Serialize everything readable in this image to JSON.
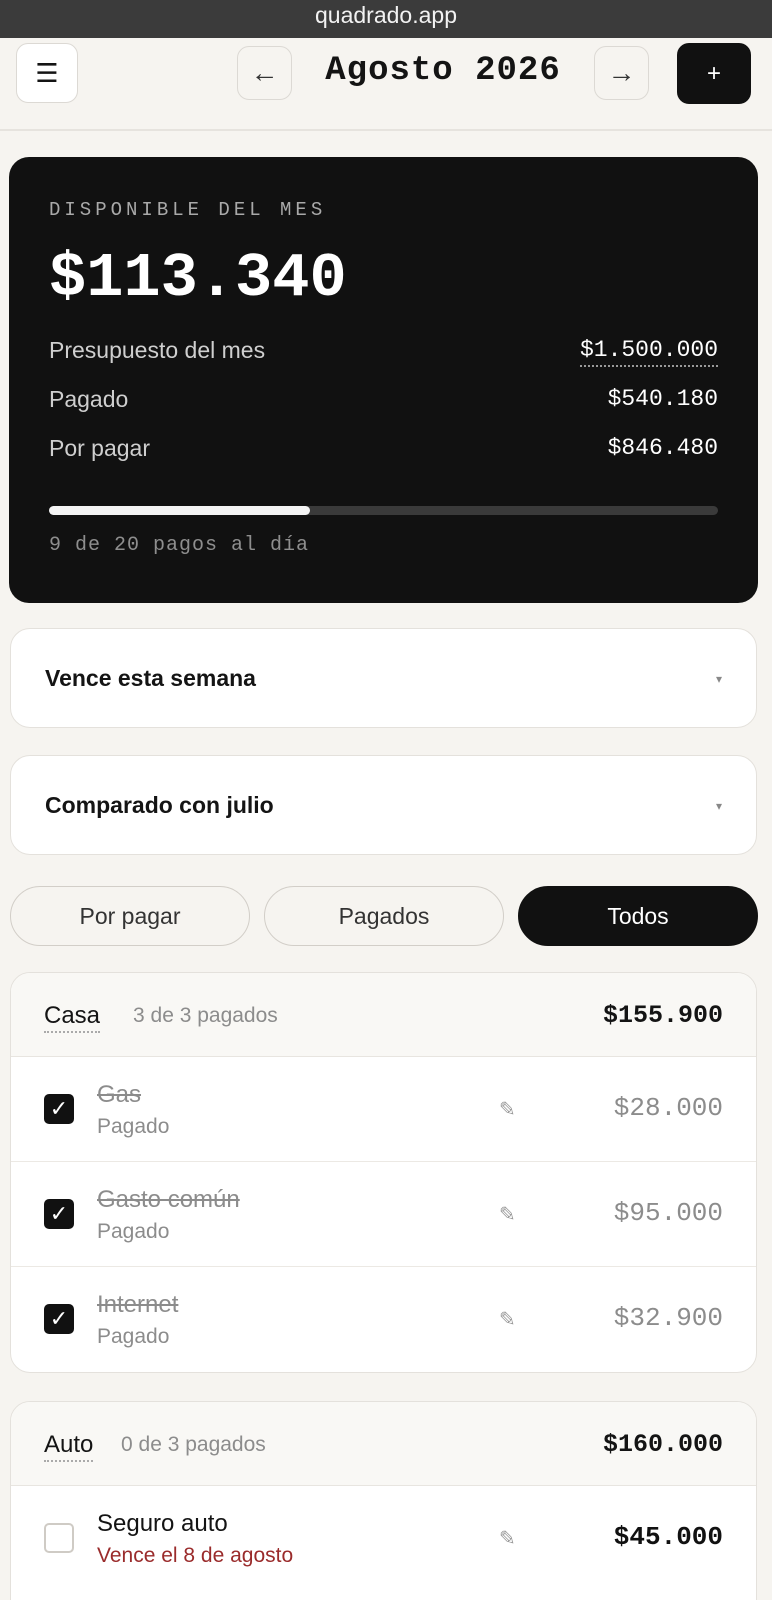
{
  "browser": {
    "url": "quadrado.app"
  },
  "header": {
    "menu_icon": "☰",
    "prev_icon": "←",
    "month_title": "Agosto 2026",
    "next_icon": "→",
    "add_icon": "+"
  },
  "summary": {
    "label": "DISPONIBLE DEL MES",
    "available": "$113.340",
    "rows": [
      {
        "label": "Presupuesto del mes",
        "value": "$1.500.000"
      },
      {
        "label": "Pagado",
        "value": "$540.180"
      },
      {
        "label": "Por pagar",
        "value": "$846.480"
      }
    ],
    "progress_fraction": 0.39,
    "footer": "9 de 20 pagos al día"
  },
  "panels": [
    {
      "title": "Vence esta semana",
      "caret": "▾"
    },
    {
      "title": "Comparado con julio",
      "caret": "▾"
    }
  ],
  "filters": [
    {
      "label": "Por pagar",
      "active": false
    },
    {
      "label": "Pagados",
      "active": false
    },
    {
      "label": "Todos",
      "active": true
    }
  ],
  "groups": [
    {
      "name": "Casa",
      "count": "3 de 3 pagados",
      "total": "$155.900",
      "items": [
        {
          "name": "Gas",
          "status": "Pagado",
          "amount": "$28.000",
          "paid": true,
          "check": "✓",
          "edit_icon": "✎"
        },
        {
          "name": "Gasto común",
          "status": "Pagado",
          "amount": "$95.000",
          "paid": true,
          "check": "✓",
          "edit_icon": "✎"
        },
        {
          "name": "Internet",
          "status": "Pagado",
          "amount": "$32.900",
          "paid": true,
          "check": "✓",
          "edit_icon": "✎"
        }
      ]
    },
    {
      "name": "Auto",
      "count": "0 de 3 pagados",
      "total": "$160.000",
      "items": [
        {
          "name": "Seguro auto",
          "status": "Vence el 8 de agosto",
          "amount": "$45.000",
          "paid": false,
          "check": "",
          "edit_icon": "✎"
        }
      ]
    }
  ],
  "colors": {
    "accent_dark": "#111111",
    "due_red": "#9a2b2b",
    "muted": "#8c8c8c",
    "page_bg": "#f6f4f0"
  }
}
